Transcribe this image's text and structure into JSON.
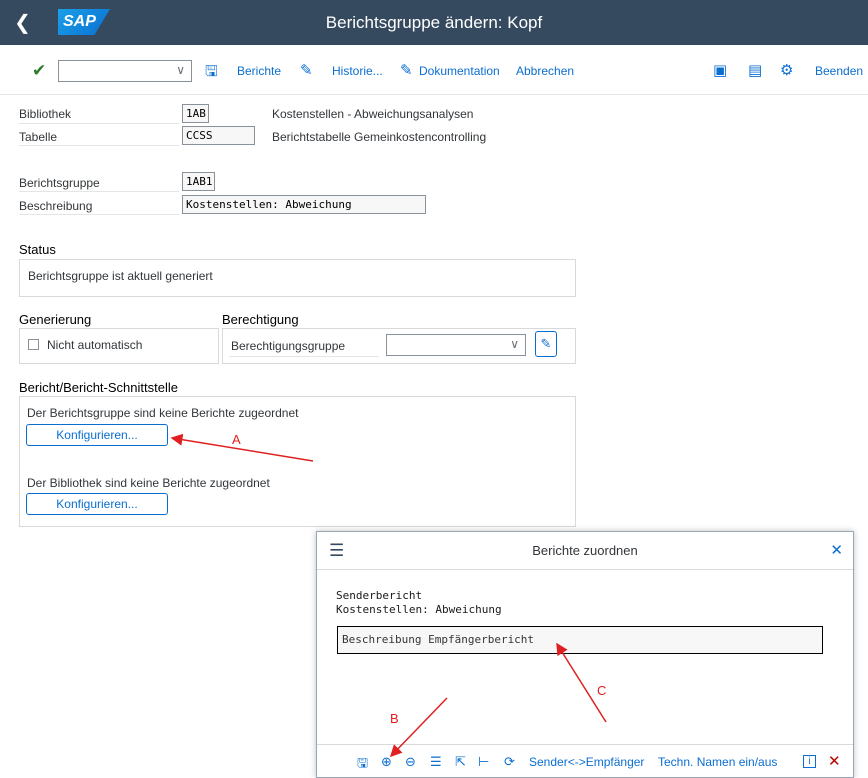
{
  "shell": {
    "back_icon": "chevron-left-icon",
    "logo": "SAP",
    "title": "Berichtsgruppe ändern: Kopf"
  },
  "toolbar": {
    "command_value": "",
    "berichte": "Berichte",
    "historie": "Historie...",
    "dokumentation": "Dokumentation",
    "abbrechen": "Abbrechen",
    "beenden": "Beenden"
  },
  "form": {
    "bibliothek_label": "Bibliothek",
    "bibliothek_value": "1AB",
    "bibliothek_desc": "Kostenstellen - Abweichungsanalysen",
    "tabelle_label": "Tabelle",
    "tabelle_value": "CCSS",
    "tabelle_desc": "Berichtstabelle Gemeinkostencontrolling",
    "gruppe_label": "Berichtsgruppe",
    "gruppe_value": "1AB1",
    "beschreibung_label": "Beschreibung",
    "beschreibung_value": "Kostenstellen: Abweichung"
  },
  "status": {
    "title": "Status",
    "text": "Berichtsgruppe ist aktuell generiert"
  },
  "generierung": {
    "title": "Generierung",
    "checkbox_label": "Nicht automatisch",
    "checked": false
  },
  "berechtigung": {
    "title": "Berechtigung",
    "label": "Berechtigungsgruppe",
    "value": ""
  },
  "schnittstelle": {
    "title": "Bericht/Bericht-Schnittstelle",
    "gruppe_text": "Der Berichtsgruppe sind keine Berichte zugeordnet",
    "button1": "Konfigurieren...",
    "bibliothek_text": "Der Bibliothek sind keine Berichte zugeordnet",
    "button2": "Konfigurieren..."
  },
  "dialog": {
    "title": "Berichte zuordnen",
    "sender_label": "Senderbericht",
    "sender_value": "Kostenstellen: Abweichung",
    "input_value": "Beschreibung Empfängerbericht",
    "sender_empfaenger": "Sender<->Empfänger",
    "techn_namen": "Techn. Namen ein/aus"
  },
  "annotations": {
    "a": "A",
    "b": "B",
    "c": "C"
  },
  "colors": {
    "shell": "#354a5f",
    "link": "#0a6ed1",
    "annotation": "#e02020"
  }
}
